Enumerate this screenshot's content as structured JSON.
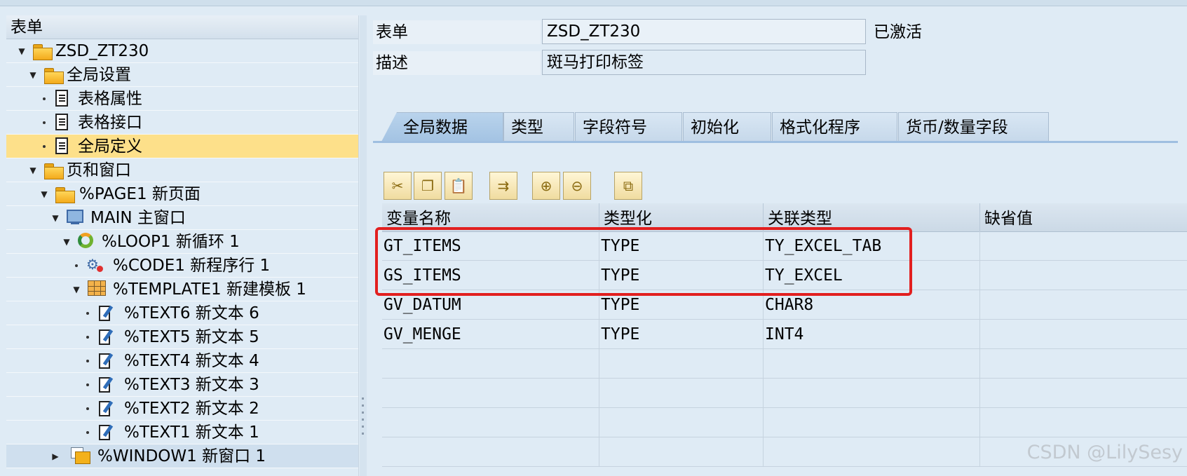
{
  "tree": {
    "header": "表单",
    "nodes": [
      {
        "label": "ZSD_ZT230"
      },
      {
        "label": "全局设置"
      },
      {
        "label": "表格属性"
      },
      {
        "label": "表格接口"
      },
      {
        "label": "全局定义"
      },
      {
        "label": "页和窗口"
      },
      {
        "id": "%PAGE1",
        "label": "新页面"
      },
      {
        "id": "MAIN",
        "label": "主窗口"
      },
      {
        "id": "%LOOP1",
        "label": "新循环 1"
      },
      {
        "id": "%CODE1",
        "label": "新程序行 1"
      },
      {
        "id": "%TEMPLATE1",
        "label": "新建模板 1"
      },
      {
        "id": "%TEXT6",
        "label": "新文本 6"
      },
      {
        "id": "%TEXT5",
        "label": "新文本 5"
      },
      {
        "id": "%TEXT4",
        "label": "新文本 4"
      },
      {
        "id": "%TEXT3",
        "label": "新文本 3"
      },
      {
        "id": "%TEXT2",
        "label": "新文本 2"
      },
      {
        "id": "%TEXT1",
        "label": "新文本 1"
      },
      {
        "id": "%WINDOW1",
        "label": "新窗口 1"
      }
    ]
  },
  "form": {
    "form_label": "表单",
    "form_value": "ZSD_ZT230",
    "status": "已激活",
    "desc_label": "描述",
    "desc_value": "斑马打印标签"
  },
  "tabs": [
    "全局数据",
    "类型",
    "字段符号",
    "初始化",
    "格式化程序",
    "货币/数量字段"
  ],
  "toolbar": [
    "cut-icon",
    "copy-icon",
    "paste-icon",
    "move-icon",
    "insert-row-icon",
    "delete-row-icon",
    "hierarchy-icon"
  ],
  "table": {
    "headers": [
      "变量名称",
      "类型化",
      "关联类型",
      "缺省值"
    ],
    "rows": [
      [
        "GT_ITEMS",
        "TYPE",
        "TY_EXCEL_TAB",
        ""
      ],
      [
        "GS_ITEMS",
        "TYPE",
        "TY_EXCEL",
        ""
      ],
      [
        "GV_DATUM",
        "TYPE",
        "CHAR8",
        ""
      ],
      [
        "GV_MENGE",
        "TYPE",
        "INT4",
        ""
      ],
      [
        "",
        "",
        "",
        ""
      ],
      [
        "",
        "",
        "",
        ""
      ],
      [
        "",
        "",
        "",
        ""
      ],
      [
        "",
        "",
        "",
        ""
      ]
    ]
  },
  "watermark": "CSDN @LilySesy",
  "colors": {
    "highlight_border": "#e21f1f",
    "selected_row": "#fde08a"
  }
}
